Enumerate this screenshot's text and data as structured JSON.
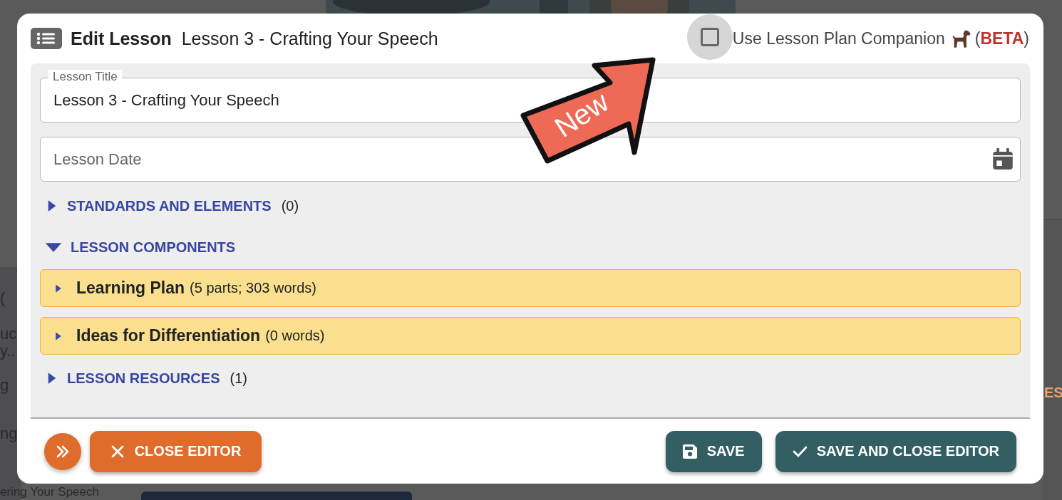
{
  "backdrop": {
    "fragments": [
      "(",
      "uc",
      "y..",
      "g",
      "ng",
      "ering Your Speech",
      "ES"
    ]
  },
  "dialog": {
    "title": "Edit Lesson",
    "subtitle": "Lesson 3 - Crafting Your Speech",
    "companion": {
      "checked": false,
      "label": "Use Lesson Plan Companion",
      "tag_open": "(",
      "tag": "BETA",
      "tag_close": ")"
    },
    "callout": {
      "text": "New"
    },
    "fields": [
      {
        "kind": "text",
        "label": "Lesson Title",
        "value": "Lesson 3 - Crafting Your Speech"
      },
      {
        "kind": "date",
        "placeholder": "Lesson Date"
      }
    ],
    "sections": [
      {
        "label": "STANDARDS AND ELEMENTS",
        "count": "(0)",
        "expanded": false
      },
      {
        "label": "LESSON COMPONENTS",
        "expanded": true,
        "children": [
          {
            "label": "Learning Plan",
            "detail": "(5 parts; 303 words)",
            "expanded": false
          },
          {
            "label": "Ideas for Differentiation",
            "detail": "(0 words)",
            "expanded": false
          }
        ]
      },
      {
        "label": "LESSON RESOURCES",
        "count": "(1)",
        "expanded": false
      }
    ],
    "buttons": [
      {
        "kind": "fab"
      },
      {
        "kind": "close",
        "label": "CLOSE EDITOR"
      },
      {
        "kind": "save",
        "label": "SAVE"
      },
      {
        "kind": "save_close",
        "label": "SAVE AND CLOSE EDITOR"
      }
    ]
  }
}
